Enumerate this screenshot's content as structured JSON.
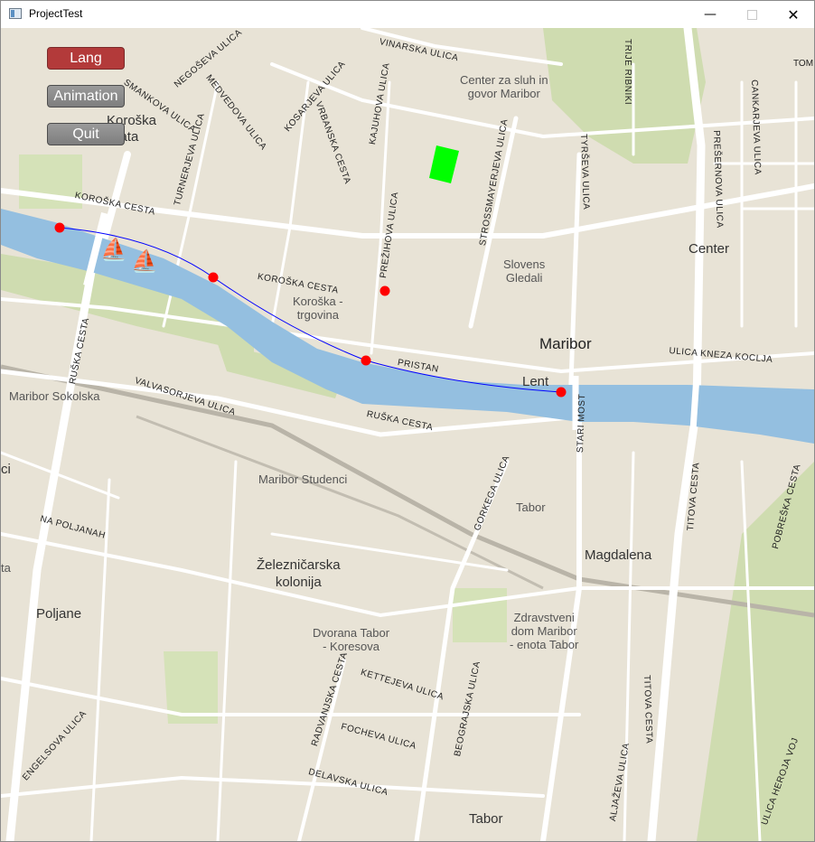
{
  "window": {
    "title": "ProjectTest",
    "controls": {
      "minimize": "—",
      "close": "✕"
    }
  },
  "buttons": {
    "lang": "Lang",
    "animation": "Animation",
    "quit": "Quit"
  },
  "icons": {
    "boat_1": "⛵",
    "boat_2": "⛵"
  },
  "map": {
    "places": {
      "koroska_vrata": "Koroška\nVrata",
      "center_za_sluh": "Center za sluh in\ngovor Maribor",
      "slovenski_gledali": "Slovens\nGledali",
      "koroska_trgovina": "Koroška -\ntrgovina",
      "maribor": "Maribor",
      "center": "Center",
      "lent": "Lent",
      "maribor_sokolska": "Maribor Sokolska",
      "maribor_studenci": "Maribor Studenci",
      "tabor_small": "Tabor",
      "magdalena": "Magdalena",
      "zelezniska_kolonija": "Železničarska\nkolonija",
      "poljane": "Poljane",
      "dvorana_tabor": "Dvorana Tabor\n- Koresova",
      "zdravstveni_dom": "Zdravstveni\ndom Maribor\n- enota Tabor",
      "tabor": "Tabor",
      "edge_ci": "ci",
      "edge_ta": "ta",
      "tom": "TOM"
    },
    "streets": {
      "vinarska": "VINARSKA ULICA",
      "negoseva": "NEGOŠEVA ULICA",
      "smankova": "SMANKOVA ULICA",
      "medvedova": "MEDVEDOVA ULICA",
      "kosarjeva": "KOSARJEVA ULICA",
      "vrbanska": "VRBANSKA CESTA",
      "kajuhova": "KAJUHOVA ULICA",
      "turnerjeva": "TURNERJEVA ULICA",
      "koroska_cesta_1": "KOROŠKA CESTA",
      "koroska_cesta_2": "KOROŠKA CESTA",
      "prezihova": "PREŽIHOVA ULICA",
      "strossmayerjeva": "STROSSMAYERJEVA ULICA",
      "tyrseva": "TYRŠEVA ULICA",
      "presernova": "PREŠERNOVA ULICA",
      "cankarjeva": "CANKARJEVA ULICA",
      "trije_ribniki": "TRIJE RIBNIKI",
      "ulica_kneza_koclja": "ULICA KNEZA KOCLJA",
      "pristan": "PRISTAN",
      "stari_most": "STARI MOST",
      "ruska_cesta_1": "RUŠKA CESTA",
      "ruska_cesta_2": "RUŠKA CESTA",
      "valvasorjeva": "VALVASORJEVA ULICA",
      "na_poljanah": "NA POLJANAH",
      "gorkega": "GORKEGA ULICA",
      "titova_1": "TITOVA CESTA",
      "titova_2": "TITOVA CESTA",
      "pobreska": "POBREŠKA CESTA",
      "radvanjska": "RADVANJSKA CESTA",
      "kettejeva": "KETTEJEVA ULICA",
      "beogrjska": "BEOGRAJSKA ULICA",
      "focheva": "FOCHEVA ULICA",
      "delavska": "DELAVSKA ULICA",
      "engelsova": "ENGELSOVA ULICA",
      "aljazeva": "ALJAŽEVA ULICA",
      "ulica_heroja": "ULICA HEROJA VOJ"
    },
    "colors": {
      "land": "#e8e3d6",
      "river": "#94bfe0",
      "park": "#cfdcb0",
      "road": "#ffffff",
      "route": "#0000ff",
      "waypoint": "#ff0000",
      "marker": "#00ff00"
    }
  }
}
